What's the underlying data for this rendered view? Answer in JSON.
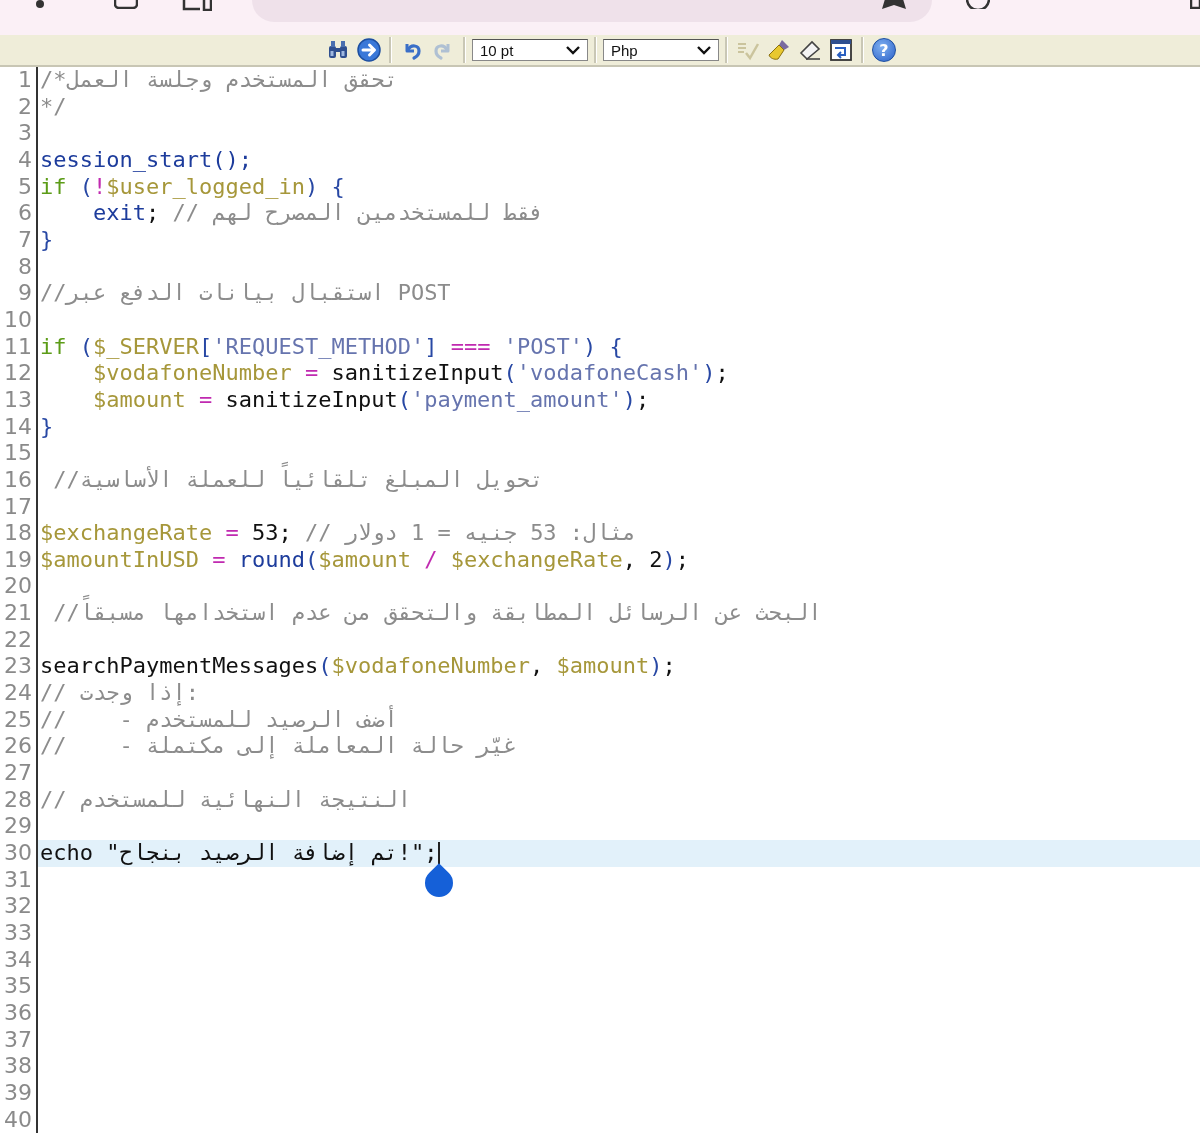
{
  "toolbar": {
    "items": [
      {
        "kind": "button",
        "disabled": false
      },
      {
        "kind": "button",
        "disabled": false
      },
      {
        "kind": "separator"
      },
      {
        "kind": "button",
        "disabled": false
      },
      {
        "kind": "button",
        "disabled": true
      },
      {
        "kind": "separator"
      },
      {
        "kind": "select",
        "value": "10 pt"
      },
      {
        "kind": "separator"
      },
      {
        "kind": "select",
        "value": "Php"
      },
      {
        "kind": "separator"
      },
      {
        "kind": "button",
        "disabled": true
      },
      {
        "kind": "button",
        "disabled": false
      },
      {
        "kind": "button",
        "disabled": false
      },
      {
        "kind": "button",
        "disabled": false
      },
      {
        "kind": "separator"
      },
      {
        "kind": "button",
        "label": "?",
        "disabled": false
      }
    ]
  },
  "editor": {
    "lines": [
      {
        "number": "1",
        "current": false,
        "tokens": [
          {
            "kind": "comment",
            "text": "/*تحقق المستخدم وجلسة العمل"
          }
        ]
      },
      {
        "number": "2",
        "current": false,
        "tokens": [
          {
            "kind": "comment",
            "text": "*/"
          }
        ]
      },
      {
        "number": "3",
        "current": false
      },
      {
        "number": "4",
        "current": false,
        "tokens": [
          {
            "kind": "function",
            "text": "session_start"
          },
          {
            "kind": "function",
            "text": "();"
          }
        ]
      },
      {
        "number": "5",
        "current": false,
        "tokens": [
          {
            "kind": "keyword",
            "text": "if"
          },
          {
            "kind": "punct",
            "text": " ("
          },
          {
            "kind": "operator",
            "text": "!"
          },
          {
            "kind": "variable",
            "text": "$user_logged_in"
          },
          {
            "kind": "punct",
            "text": ") {"
          }
        ]
      },
      {
        "number": "6",
        "current": false,
        "tokens": [
          {
            "kind": "function",
            "text": "    exit"
          },
          {
            "kind": "plain",
            "text": "; "
          },
          {
            "kind": "comment",
            "text": "// فقط للمستخدمين المصرح لهم"
          }
        ]
      },
      {
        "number": "7",
        "current": false,
        "tokens": [
          {
            "kind": "punct",
            "text": "}"
          }
        ]
      },
      {
        "number": "8",
        "current": false
      },
      {
        "number": "9",
        "current": false,
        "tokens": [
          {
            "kind": "comment",
            "text": "//استقبال بيانات الدفع عبر POST"
          }
        ]
      },
      {
        "number": "10",
        "current": false
      },
      {
        "number": "11",
        "current": false,
        "tokens": [
          {
            "kind": "keyword",
            "text": "if"
          },
          {
            "kind": "punct",
            "text": " ("
          },
          {
            "kind": "variable",
            "text": "$_SERVER"
          },
          {
            "kind": "punct",
            "text": "["
          },
          {
            "kind": "string",
            "text": "'REQUEST_METHOD'"
          },
          {
            "kind": "punct",
            "text": "] "
          },
          {
            "kind": "operator",
            "text": "==="
          },
          {
            "kind": "string",
            "text": " 'POST'"
          },
          {
            "kind": "punct",
            "text": ") {"
          }
        ]
      },
      {
        "number": "12",
        "current": false,
        "tokens": [
          {
            "kind": "variable",
            "text": "    $vodafoneNumber "
          },
          {
            "kind": "operator",
            "text": "="
          },
          {
            "kind": "plain",
            "text": " sanitizeInput"
          },
          {
            "kind": "punct",
            "text": "("
          },
          {
            "kind": "string",
            "text": "'vodafoneCash'"
          },
          {
            "kind": "punct",
            "text": ")"
          },
          {
            "kind": "plain",
            "text": ";"
          }
        ]
      },
      {
        "number": "13",
        "current": false,
        "tokens": [
          {
            "kind": "variable",
            "text": "    $amount "
          },
          {
            "kind": "operator",
            "text": "="
          },
          {
            "kind": "plain",
            "text": " sanitizeInput"
          },
          {
            "kind": "punct",
            "text": "("
          },
          {
            "kind": "string",
            "text": "'payment_amount'"
          },
          {
            "kind": "punct",
            "text": ")"
          },
          {
            "kind": "plain",
            "text": ";"
          }
        ]
      },
      {
        "number": "14",
        "current": false,
        "tokens": [
          {
            "kind": "punct",
            "text": "}"
          }
        ]
      },
      {
        "number": "15",
        "current": false
      },
      {
        "number": "16",
        "current": false,
        "tokens": [
          {
            "kind": "comment",
            "text": " //تحويل المبلغ تلقائياً للعملة الأساسية"
          }
        ]
      },
      {
        "number": "17",
        "current": false
      },
      {
        "number": "18",
        "current": false,
        "tokens": [
          {
            "kind": "variable",
            "text": "$exchangeRate "
          },
          {
            "kind": "operator",
            "text": "="
          },
          {
            "kind": "plain",
            "text": " 53; "
          },
          {
            "kind": "comment",
            "text": "// مثال: 53 جنيه = 1 دولار"
          }
        ]
      },
      {
        "number": "19",
        "current": false,
        "tokens": [
          {
            "kind": "variable",
            "text": "$amountInUSD "
          },
          {
            "kind": "operator",
            "text": "="
          },
          {
            "kind": "function",
            "text": " round"
          },
          {
            "kind": "punct",
            "text": "("
          },
          {
            "kind": "variable",
            "text": "$amount "
          },
          {
            "kind": "operator",
            "text": "/"
          },
          {
            "kind": "variable",
            "text": " $exchangeRate"
          },
          {
            "kind": "plain",
            "text": ", 2"
          },
          {
            "kind": "punct",
            "text": ")"
          },
          {
            "kind": "plain",
            "text": ";"
          }
        ]
      },
      {
        "number": "20",
        "current": false
      },
      {
        "number": "21",
        "current": false,
        "tokens": [
          {
            "kind": "comment",
            "text": " //البحث عن الرسائل المطابقة والتحقق من عدم استخدامها مسبقاً"
          }
        ]
      },
      {
        "number": "22",
        "current": false
      },
      {
        "number": "23",
        "current": false,
        "tokens": [
          {
            "kind": "plain",
            "text": "searchPaymentMessages"
          },
          {
            "kind": "punct",
            "text": "("
          },
          {
            "kind": "variable",
            "text": "$vodafoneNumber"
          },
          {
            "kind": "plain",
            "text": ", "
          },
          {
            "kind": "variable",
            "text": "$amount"
          },
          {
            "kind": "punct",
            "text": ")"
          },
          {
            "kind": "plain",
            "text": ";"
          }
        ]
      },
      {
        "number": "24",
        "current": false,
        "tokens": [
          {
            "kind": "comment",
            "text": "// إذا وجدت:"
          }
        ]
      },
      {
        "number": "25",
        "current": false,
        "tokens": [
          {
            "kind": "comment",
            "text": "//    - أضف الرصيد للمستخدم"
          }
        ]
      },
      {
        "number": "26",
        "current": false,
        "tokens": [
          {
            "kind": "comment",
            "text": "//    - غيّر حالة المعاملة إلى مكتملة"
          }
        ]
      },
      {
        "number": "27",
        "current": false
      },
      {
        "number": "28",
        "current": false,
        "tokens": [
          {
            "kind": "comment",
            "text": "// النتيجة النهائية للمستخدم"
          }
        ]
      },
      {
        "number": "29",
        "current": false
      },
      {
        "number": "30",
        "current": true,
        "tokens": [
          {
            "kind": "plain",
            "text": "echo \"تم إضافة الرصيد بنجاح!\";"
          }
        ]
      },
      {
        "number": "31",
        "current": false
      },
      {
        "number": "32",
        "current": false
      },
      {
        "number": "33",
        "current": false
      },
      {
        "number": "34",
        "current": false
      },
      {
        "number": "35",
        "current": false
      },
      {
        "number": "36",
        "current": false
      },
      {
        "number": "37",
        "current": false
      },
      {
        "number": "38",
        "current": false
      },
      {
        "number": "39",
        "current": false
      },
      {
        "number": "40",
        "current": false
      }
    ]
  }
}
